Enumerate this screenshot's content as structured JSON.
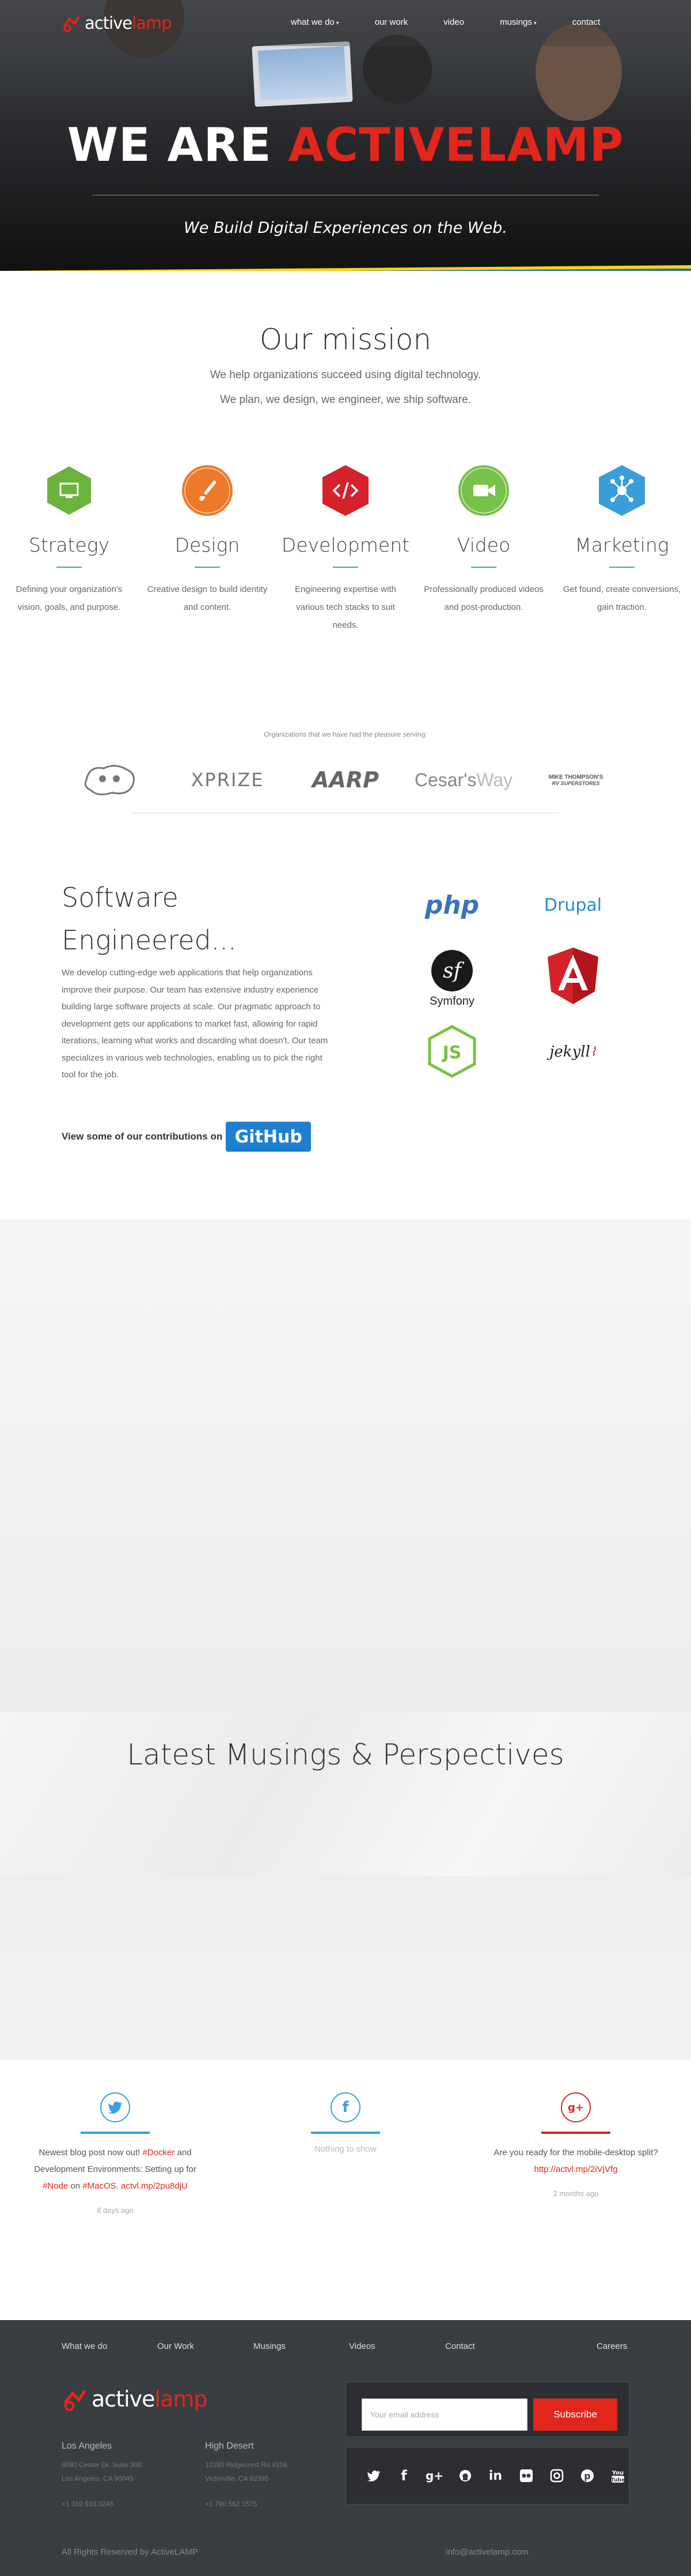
{
  "nav": {
    "logo_active": "active",
    "logo_lamp": "lamp",
    "items": [
      {
        "label": "what we do",
        "dropdown": true
      },
      {
        "label": "our work",
        "dropdown": false
      },
      {
        "label": "video",
        "dropdown": false
      },
      {
        "label": "musings",
        "dropdown": true
      },
      {
        "label": "contact",
        "dropdown": false
      }
    ]
  },
  "hero": {
    "title_white": "WE ARE",
    "title_red": "ACTIVELAMP",
    "subtitle": "We Build Digital Experiences on the Web."
  },
  "mission": {
    "title": "Our mission",
    "line1": "We help organizations succeed using digital technology.",
    "line2": "We plan, we design, we engineer, we ship software."
  },
  "services": [
    {
      "title": "Strategy",
      "desc": "Defining your organization's vision, goals, and purpose.",
      "color": "#6cb33e",
      "icon": "monitor-icon"
    },
    {
      "title": "Design",
      "desc": "Creative design to build identity and content.",
      "color": "#ec7a2a",
      "icon": "paintbrush-icon"
    },
    {
      "title": "Development",
      "desc": "Engineering expertise with various tech stacks to suit needs.",
      "color": "#d4212a",
      "icon": "code-icon"
    },
    {
      "title": "Video",
      "desc": "Professionally produced videos and post-production.",
      "color": "#78c14a",
      "icon": "video-camera-icon"
    },
    {
      "title": "Marketing",
      "desc": "Get found, create conversions, gain traction.",
      "color": "#3a9fd8",
      "icon": "network-icon"
    }
  ],
  "clients": {
    "caption": "Organizations that we have had the pleasure serving:",
    "logos": [
      "XPRIZE",
      "AARP",
      "Cesar's",
      "Way",
      "MIKE THOMPSON'S",
      "RV SUPERSTORES"
    ]
  },
  "software": {
    "title_line1": "Software",
    "title_line2": "Engineered...",
    "text": "We develop cutting-edge web applications that help organizations improve their purpose. Our team has extensive industry experience building large software projects at scale. Our pragmatic approach to development gets our applications to market fast, allowing for rapid iterations, learning what works and discarding what doesn't. Our team specializes in various web technologies, enabling us to pick the right tool for the job.",
    "github_text": "View some of our contributions on",
    "github_button": "GitHub",
    "tech": [
      "php",
      "Drupal",
      "Symfony",
      "JS",
      "jekyll"
    ]
  },
  "musings": {
    "title": "Latest Musings & Perspectives"
  },
  "social": [
    {
      "network": "twitter",
      "color": "#3aa0dd",
      "text_parts": [
        "Newest blog post now out! ",
        "#Docker",
        " and Development Environments: Setting up for ",
        "#Node",
        " on ",
        "#MacOS",
        ". ",
        "actvl.mp/2pu8djU"
      ],
      "time": "8 days ago"
    },
    {
      "network": "facebook",
      "color": "#3aa0dd",
      "empty_text": "Nothing to show"
    },
    {
      "network": "google-plus",
      "color": "#e1261c",
      "text_parts": [
        "Are you ready for the mobile-desktop split? ",
        "http://actvl.mp/2iVjVfg"
      ],
      "time": "2 months ago"
    }
  ],
  "footer": {
    "nav": [
      "What we do",
      "Our Work",
      "Musings",
      "Videos",
      "Contact",
      "Careers"
    ],
    "logo_active": "active",
    "logo_lamp": "lamp",
    "offices": [
      {
        "name": "Los Angeles",
        "line1": "8080 Center Dr. Suite 300",
        "line2": "Los Angeles, CA 90045",
        "phone": "+1 310 933 0246"
      },
      {
        "name": "High Desert",
        "line1": "12180 Ridgecrest Rd #106",
        "line2": "Victorville, CA 92395",
        "phone": "+1 760 562 1575"
      }
    ],
    "email_placeholder": "Your email address",
    "subscribe": "Subscribe",
    "social_icons": [
      "twitter-icon",
      "facebook-icon",
      "google-plus-icon",
      "github-icon",
      "linkedin-icon",
      "flickr-icon",
      "instagram-icon",
      "pinterest-icon",
      "youtube-icon"
    ],
    "copyright": "All Rights Reserved by ActiveLAMP",
    "contact_email": "info@activelamp.com"
  }
}
